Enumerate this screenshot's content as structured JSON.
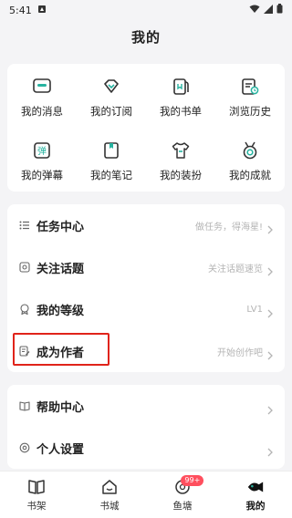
{
  "status": {
    "time": "5:41"
  },
  "page": {
    "title": "我的"
  },
  "grid": [
    {
      "label": "我的消息",
      "icon": "message-icon"
    },
    {
      "label": "我的订阅",
      "icon": "subscription-diamond-icon"
    },
    {
      "label": "我的书单",
      "icon": "booklist-icon"
    },
    {
      "label": "浏览历史",
      "icon": "history-icon"
    },
    {
      "label": "我的弹幕",
      "icon": "danmaku-icon"
    },
    {
      "label": "我的笔记",
      "icon": "notes-icon"
    },
    {
      "label": "我的装扮",
      "icon": "tshirt-icon"
    },
    {
      "label": "我的成就",
      "icon": "medal-icon"
    }
  ],
  "list1": [
    {
      "title": "任务中心",
      "hint": "做任务，得海星!"
    },
    {
      "title": "关注话题",
      "hint": "关注话题速览"
    },
    {
      "title": "我的等级",
      "hint": "LV1"
    },
    {
      "title": "成为作者",
      "hint": "开始创作吧"
    }
  ],
  "list2": [
    {
      "title": "帮助中心",
      "hint": ""
    },
    {
      "title": "个人设置",
      "hint": ""
    }
  ],
  "tabs": [
    {
      "label": "书架"
    },
    {
      "label": "书城"
    },
    {
      "label": "鱼塘",
      "badge": "99+"
    },
    {
      "label": "我的",
      "active": true
    }
  ],
  "colors": {
    "accent": "#27b3a0",
    "highlight": "#e0231a",
    "badge": "#ff4f5e"
  }
}
